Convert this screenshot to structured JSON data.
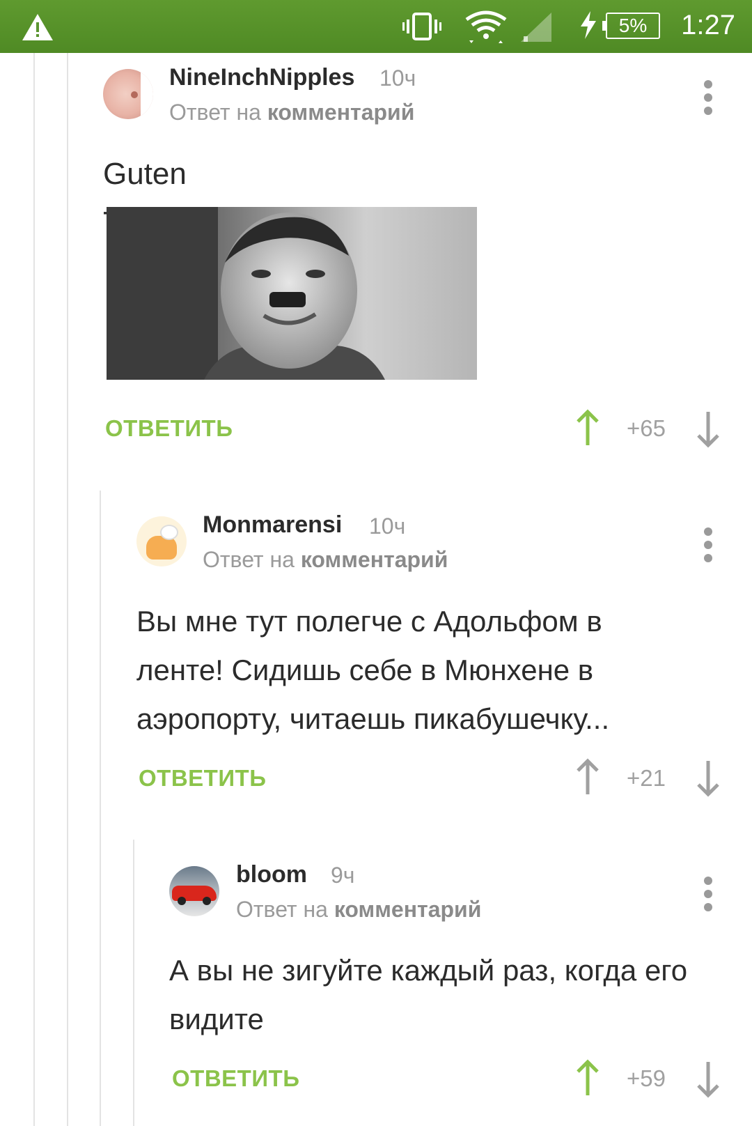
{
  "status_bar": {
    "battery": "5%",
    "time": "1:27"
  },
  "colors": {
    "accent": "#8bc34a",
    "status_bar": "#5a9530",
    "text": "#2b2b2b",
    "muted": "#9a9a9a"
  },
  "comments": [
    {
      "author": "NineInchNipples",
      "time": "10ч",
      "reply_prefix": "Ответ на",
      "reply_link": "комментарий",
      "text": "Guten Tag.",
      "reply_label": "ОТВЕТИТЬ",
      "score": "+65",
      "upvote_active": true
    },
    {
      "author": "Monmarensi",
      "time": "10ч",
      "reply_prefix": "Ответ на",
      "reply_link": "комментарий",
      "text": "Вы мне тут полегче с Адольфом в ленте! Сидишь себе в Мюнхене в аэропорту, читаешь пикабушечку...",
      "reply_label": "ОТВЕТИТЬ",
      "score": "+21",
      "upvote_active": false
    },
    {
      "author": "bloom",
      "time": "9ч",
      "reply_prefix": "Ответ на",
      "reply_link": "комментарий",
      "text": "А вы не зигуйте каждый раз, когда его видите",
      "reply_label": "ОТВЕТИТЬ",
      "score": "+59",
      "upvote_active": true
    }
  ]
}
